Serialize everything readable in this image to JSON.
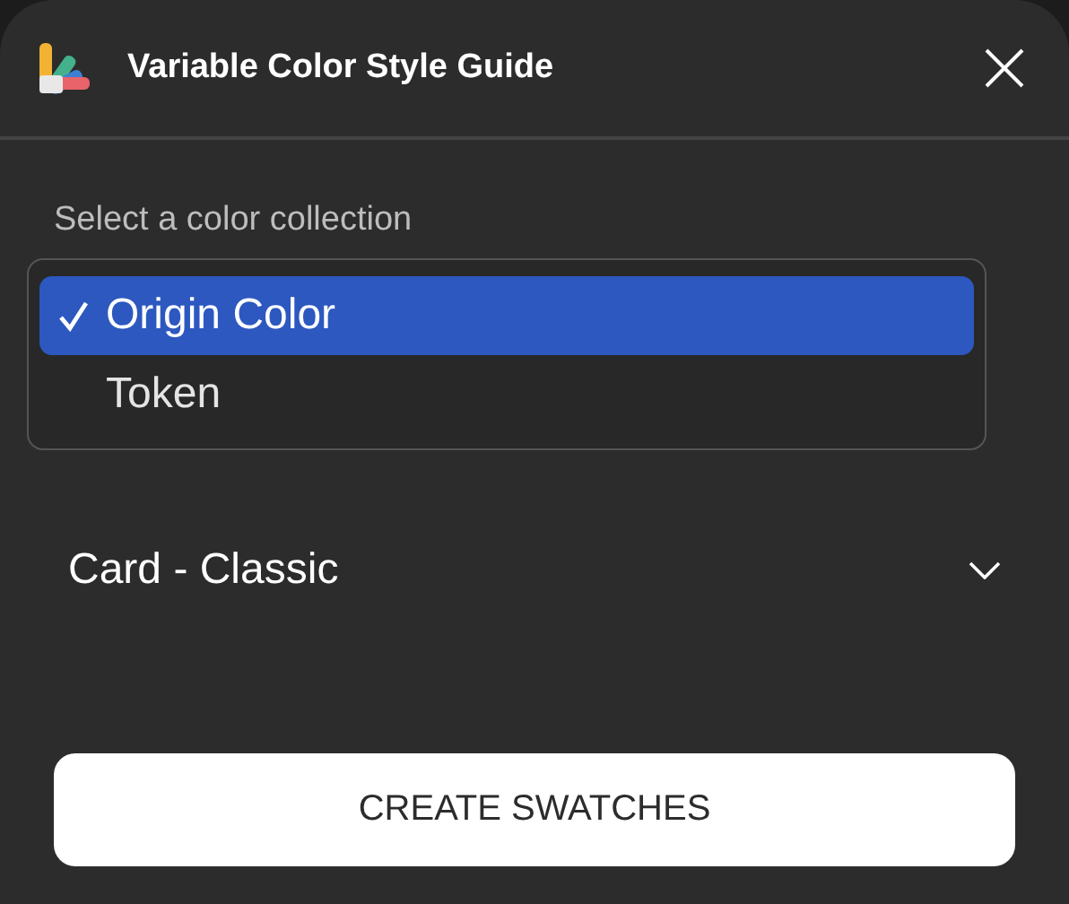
{
  "window": {
    "title": "Variable Color Style Guide"
  },
  "collection": {
    "label": "Select a color collection",
    "options": [
      {
        "label": "Origin Color",
        "selected": true
      },
      {
        "label": "Token",
        "selected": false
      }
    ]
  },
  "swatch_style": {
    "value": "Card - Classic"
  },
  "button": "CREATE SWATCHES"
}
